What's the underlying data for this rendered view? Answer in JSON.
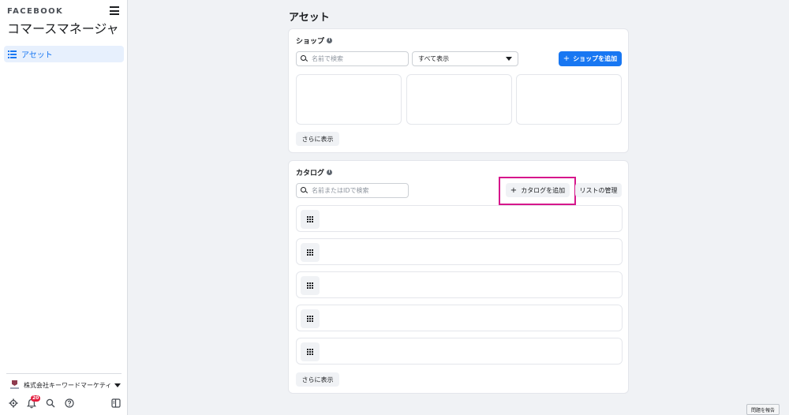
{
  "sidebar": {
    "brand": "FACEBOOK",
    "app_title": "コマースマネージャ",
    "nav_items": [
      {
        "label": "アセット",
        "icon": "list-icon",
        "active": true
      }
    ],
    "company_name": "株式会社キーワードマーケティング",
    "notification_count": "20",
    "footer_icons": [
      "gear-icon",
      "bell-icon",
      "search-icon",
      "help-icon",
      "sidebar-toggle-icon"
    ]
  },
  "main": {
    "title": "アセット",
    "shop": {
      "title": "ショップ",
      "search_placeholder": "名前で検索",
      "filter_value": "すべて表示",
      "add_label": "ショップを追加",
      "add_icon": "+",
      "more_label": "さらに表示"
    },
    "catalog": {
      "title": "カタログ",
      "search_placeholder": "名前またはIDで検索",
      "add_label": "カタログを追加",
      "add_icon": "+",
      "manage_label": "リストの管理",
      "more_label": "さらに表示",
      "row_count": 5
    }
  },
  "footer": {
    "report_label": "問題を報告"
  },
  "colors": {
    "accent": "#1877f2",
    "highlight": "#d6168b",
    "background": "#f0f2f5"
  }
}
